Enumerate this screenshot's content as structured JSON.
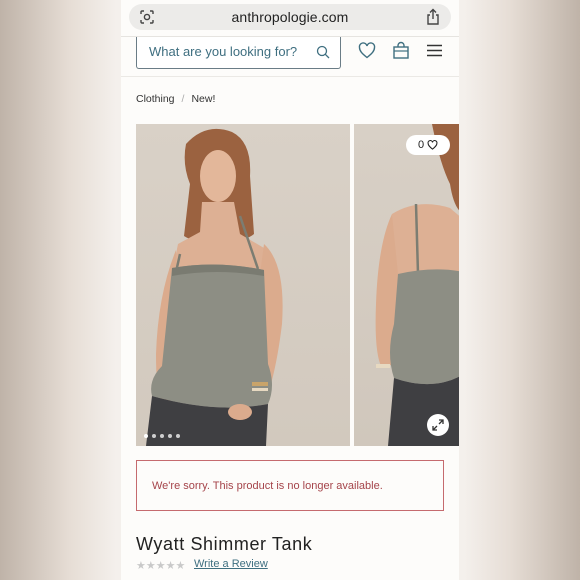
{
  "browser": {
    "url": "anthropologie.com"
  },
  "header": {
    "search_placeholder": "What are you looking for?"
  },
  "breadcrumb": [
    "Clothing",
    "/",
    "New!"
  ],
  "gallery": {
    "favorites_count": "0",
    "dots": 5,
    "active_dot": 0
  },
  "notice": {
    "text": "We're sorry. This product is no longer available."
  },
  "product": {
    "title": "Wyatt Shimmer Tank",
    "stars": "★★★★★",
    "review_link": "Write a Review"
  },
  "colors": {
    "accent": "#3f6f80",
    "error": "#a5444a"
  }
}
